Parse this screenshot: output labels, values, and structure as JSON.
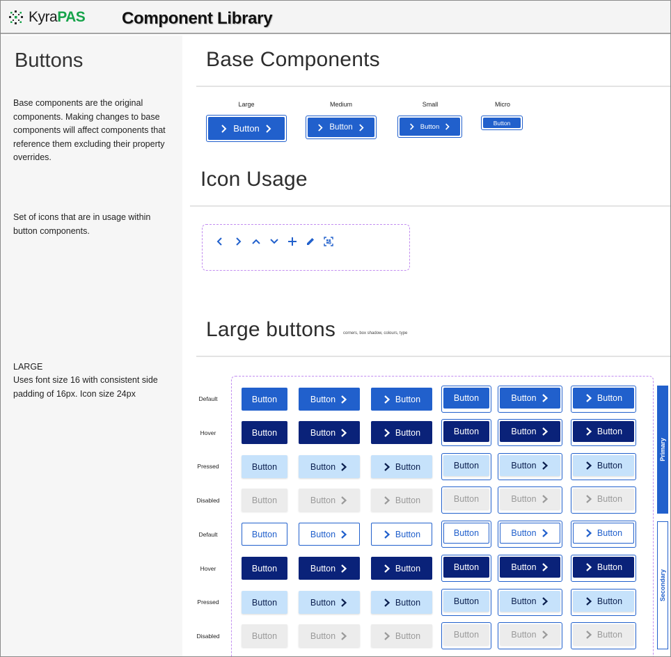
{
  "header": {
    "logo_primary": "Kyra",
    "logo_secondary": "PAS",
    "title": "Component Library"
  },
  "sidebar": {
    "title": "Buttons",
    "base_description": "Base components are the original components. Making changes to base components will affect components that reference them excluding their property overrides.",
    "icon_description": "Set of icons that are in usage within button components.",
    "large_heading": "LARGE",
    "large_description": "Uses font size 16 with consistent side padding of 16px. Icon size 24px"
  },
  "sections": {
    "base": "Base Components",
    "icons": "Icon Usage",
    "large": "Large buttons",
    "large_note": "corners, box shadow, colours, type"
  },
  "base_sizes": [
    {
      "label": "Large",
      "button": "Button"
    },
    {
      "label": "Medium",
      "button": "Button"
    },
    {
      "label": "Small",
      "button": "Button"
    },
    {
      "label": "Micro",
      "button": "Button"
    }
  ],
  "icons": [
    "chevron-left-icon",
    "chevron-right-icon",
    "chevron-up-icon",
    "chevron-down-icon",
    "plus-icon",
    "pencil-icon",
    "qr-scan-icon"
  ],
  "state_labels": [
    "Default",
    "Hover",
    "Pressed",
    "Disabled",
    "Default",
    "Hover",
    "Pressed",
    "Disabled"
  ],
  "group_labels": {
    "primary": "Primary",
    "secondary": "Secondary"
  },
  "button_label": "Button",
  "colors": {
    "primary": "#2160cc",
    "hover": "#0a2279",
    "pressed": "#c6e2fb",
    "disabled_bg": "#ececec",
    "disabled_text": "#9a9a9a",
    "dashed": "#c28cf0"
  }
}
